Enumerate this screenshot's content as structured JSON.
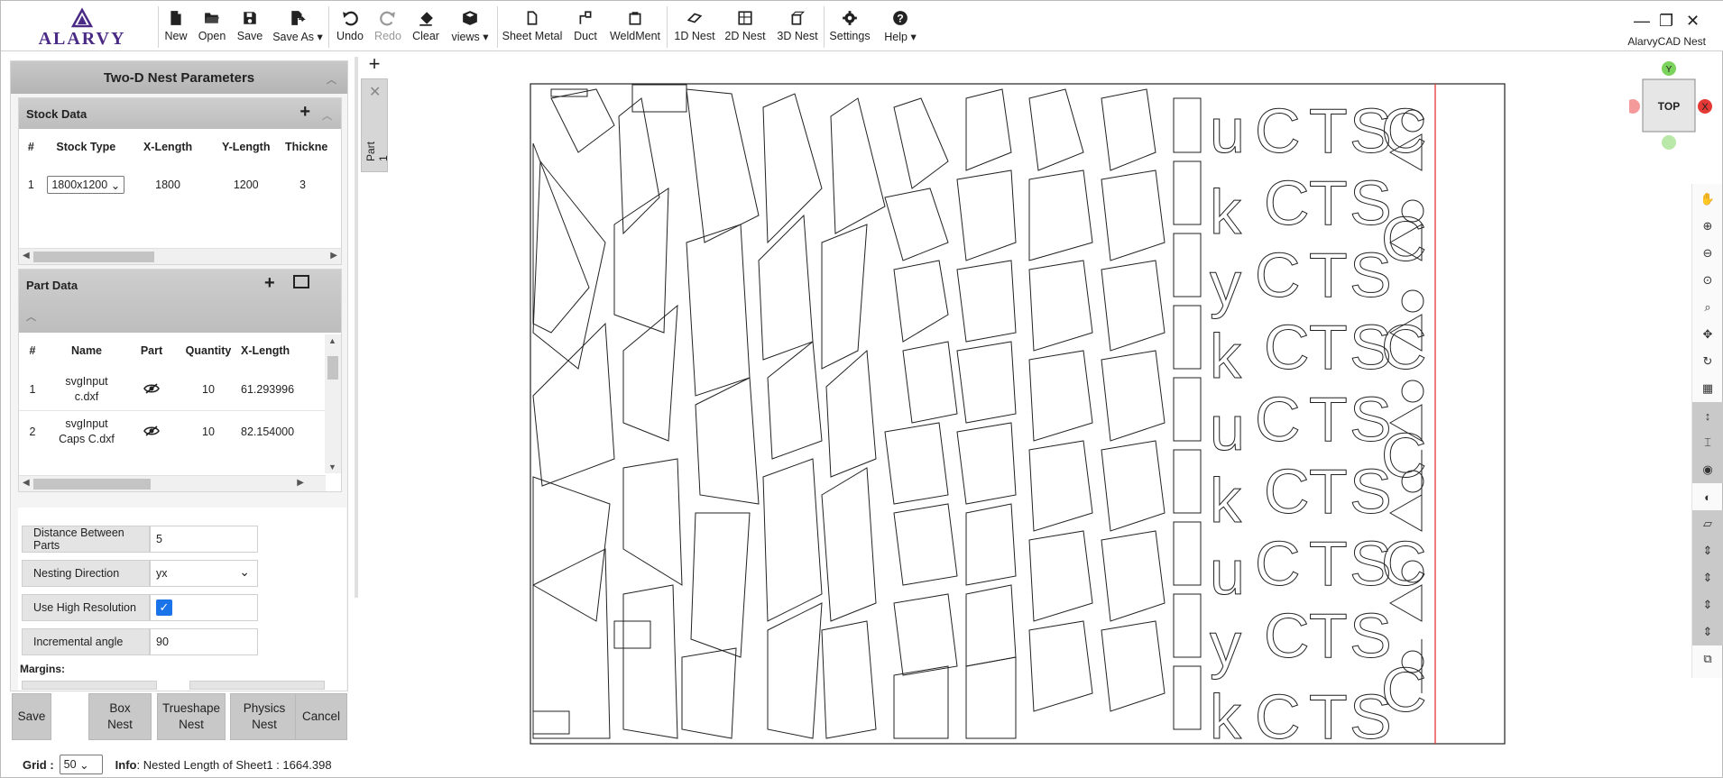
{
  "toolbar": {
    "logo_text": "ALARVY",
    "buttons": [
      {
        "label": "New",
        "icon": "new-file-icon"
      },
      {
        "label": "Open",
        "icon": "folder-open-icon"
      },
      {
        "label": "Save",
        "icon": "floppy-disk-icon"
      },
      {
        "label": "Save As",
        "icon": "save-as-icon"
      },
      {
        "label": "Undo",
        "icon": "undo-icon"
      },
      {
        "label": "Redo",
        "icon": "redo-icon"
      },
      {
        "label": "Clear",
        "icon": "eraser-icon"
      },
      {
        "label": "views",
        "icon": "cube-icon"
      },
      {
        "label": "Sheet Metal",
        "icon": "sheet-metal-icon"
      },
      {
        "label": "Duct",
        "icon": "duct-icon"
      },
      {
        "label": "WeldMent",
        "icon": "weldment-icon"
      },
      {
        "label": "1D Nest",
        "icon": "nest-1d-icon"
      },
      {
        "label": "2D Nest",
        "icon": "nest-2d-icon"
      },
      {
        "label": "3D Nest",
        "icon": "nest-3d-icon"
      },
      {
        "label": "Settings",
        "icon": "gear-icon"
      },
      {
        "label": "Help",
        "icon": "help-icon"
      }
    ],
    "app_name": "AlarvyCAD Nest"
  },
  "panel": {
    "title": "Two-D Nest Parameters",
    "stock": {
      "title": "Stock Data",
      "columns": [
        "#",
        "Stock Type",
        "X-Length",
        "Y-Length",
        "Thickne"
      ],
      "rows": [
        {
          "num": "1",
          "type": "1800x1200",
          "x": "1800",
          "y": "1200",
          "t": "3"
        }
      ]
    },
    "parts": {
      "title": "Part Data",
      "columns": [
        "#",
        "Name",
        "Part",
        "Quantity",
        "X-Length"
      ],
      "rows": [
        {
          "num": "1",
          "name1": "svgInput",
          "name2": "c.dxf",
          "qty": "10",
          "x": "61.293996"
        },
        {
          "num": "2",
          "name1": "svgInput",
          "name2": "Caps C.dxf",
          "qty": "10",
          "x": "82.154000"
        }
      ]
    },
    "form": {
      "distance_label": "Distance Between Parts",
      "distance_value": "5",
      "direction_label": "Nesting Direction",
      "direction_value": "yx",
      "highres_label": "Use High Resolution",
      "highres_checked": true,
      "angle_label": "Incremental angle",
      "angle_value": "90",
      "margins_label": "Margins:"
    },
    "buttons": {
      "save": "Save",
      "box_nest_1": "Box",
      "box_nest_2": "Nest",
      "trueshape_1": "Trueshape",
      "trueshape_2": "Nest",
      "physics_1": "Physics",
      "physics_2": "Nest",
      "cancel": "Cancel"
    }
  },
  "status": {
    "grid_label": "Grid :",
    "grid_value": "50",
    "info_label": "Info",
    "info_text": ": Nested Length of Sheet1 : 1664.398"
  },
  "part_tab": {
    "label": "Part 1"
  },
  "viewcube": {
    "face": "TOP",
    "y_label": "Y",
    "x_label": "X"
  },
  "colors": {
    "accent": "#1a73e8",
    "nest_line": "#e53935",
    "panel_header": "#bdbdbd"
  }
}
